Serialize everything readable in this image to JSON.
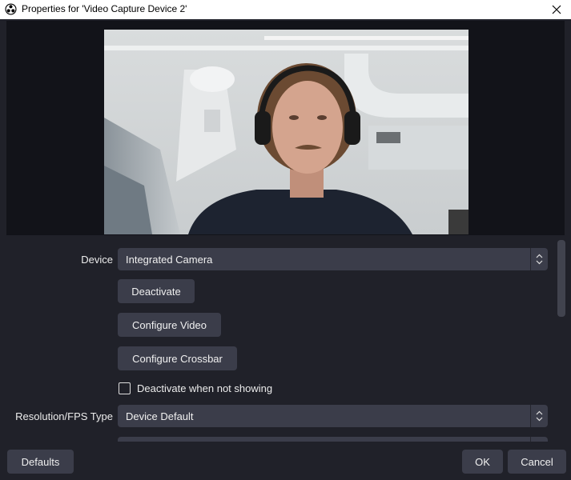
{
  "window": {
    "title": "Properties for 'Video Capture Device 2'",
    "app_icon": "obs-icon",
    "close_icon": "close-icon"
  },
  "preview": {
    "content": "webcam-feed"
  },
  "properties": {
    "device": {
      "label": "Device",
      "value": "Integrated Camera"
    },
    "deactivate_label": "Deactivate",
    "configure_video_label": "Configure Video",
    "configure_crossbar_label": "Configure Crossbar",
    "deactivate_when_not_showing": {
      "label": "Deactivate when not showing",
      "checked": false
    },
    "resolution_fps_type": {
      "label": "Resolution/FPS Type",
      "value": "Device Default"
    }
  },
  "footer": {
    "defaults_label": "Defaults",
    "ok_label": "OK",
    "cancel_label": "Cancel"
  },
  "colors": {
    "background": "#202129",
    "control": "#3b3d4a",
    "preview_background": "#121319",
    "titlebar": "#ffffff"
  }
}
